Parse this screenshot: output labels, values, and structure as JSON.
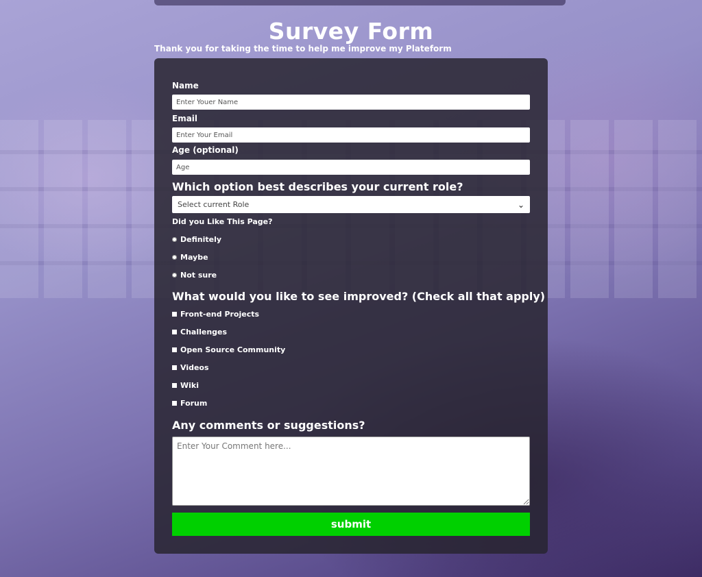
{
  "header": {
    "title": "Survey Form",
    "subtitle": "Thank you for taking the time to help me improve my Plateform"
  },
  "form": {
    "name": {
      "label": "Name",
      "placeholder": "Enter Youer Name"
    },
    "email": {
      "label": "Email",
      "placeholder": "Enter Your Email"
    },
    "age": {
      "label": "Age (optional)",
      "placeholder": "Age"
    },
    "role": {
      "question": "Which option best describes your current role?",
      "selected": "Select current Role"
    },
    "like": {
      "question": "Did you Like This Page?",
      "options": [
        "Definitely",
        "Maybe",
        "Not sure"
      ]
    },
    "improve": {
      "question": "What would you like to see improved? (Check all that apply)",
      "options": [
        "Front-end Projects",
        "Challenges",
        "Open Source Community",
        "Videos",
        "Wiki",
        "Forum"
      ]
    },
    "comments": {
      "question": "Any comments or suggestions?",
      "placeholder": "Enter Your Comment here..."
    },
    "submit_label": "submit"
  },
  "colors": {
    "submit": "#00d000",
    "card": "#28242f"
  },
  "icons": {
    "select": "chevron-down-icon"
  }
}
